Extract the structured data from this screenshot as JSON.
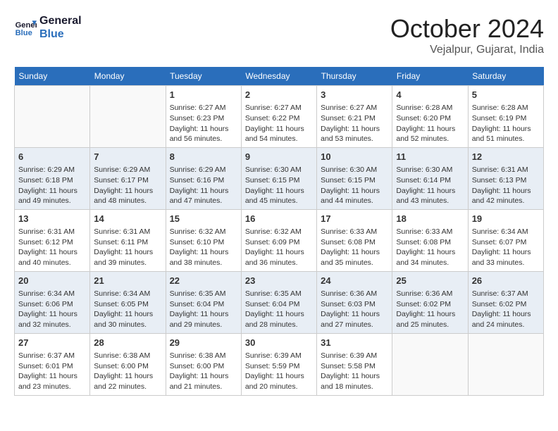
{
  "logo": {
    "line1": "General",
    "line2": "Blue"
  },
  "title": "October 2024",
  "location": "Vejalpur, Gujarat, India",
  "weekdays": [
    "Sunday",
    "Monday",
    "Tuesday",
    "Wednesday",
    "Thursday",
    "Friday",
    "Saturday"
  ],
  "weeks": [
    [
      {
        "day": null
      },
      {
        "day": null
      },
      {
        "day": "1",
        "sunrise": "6:27 AM",
        "sunset": "6:23 PM",
        "daylight": "11 hours and 56 minutes."
      },
      {
        "day": "2",
        "sunrise": "6:27 AM",
        "sunset": "6:22 PM",
        "daylight": "11 hours and 54 minutes."
      },
      {
        "day": "3",
        "sunrise": "6:27 AM",
        "sunset": "6:21 PM",
        "daylight": "11 hours and 53 minutes."
      },
      {
        "day": "4",
        "sunrise": "6:28 AM",
        "sunset": "6:20 PM",
        "daylight": "11 hours and 52 minutes."
      },
      {
        "day": "5",
        "sunrise": "6:28 AM",
        "sunset": "6:19 PM",
        "daylight": "11 hours and 51 minutes."
      }
    ],
    [
      {
        "day": "6",
        "sunrise": "6:29 AM",
        "sunset": "6:18 PM",
        "daylight": "11 hours and 49 minutes."
      },
      {
        "day": "7",
        "sunrise": "6:29 AM",
        "sunset": "6:17 PM",
        "daylight": "11 hours and 48 minutes."
      },
      {
        "day": "8",
        "sunrise": "6:29 AM",
        "sunset": "6:16 PM",
        "daylight": "11 hours and 47 minutes."
      },
      {
        "day": "9",
        "sunrise": "6:30 AM",
        "sunset": "6:15 PM",
        "daylight": "11 hours and 45 minutes."
      },
      {
        "day": "10",
        "sunrise": "6:30 AM",
        "sunset": "6:15 PM",
        "daylight": "11 hours and 44 minutes."
      },
      {
        "day": "11",
        "sunrise": "6:30 AM",
        "sunset": "6:14 PM",
        "daylight": "11 hours and 43 minutes."
      },
      {
        "day": "12",
        "sunrise": "6:31 AM",
        "sunset": "6:13 PM",
        "daylight": "11 hours and 42 minutes."
      }
    ],
    [
      {
        "day": "13",
        "sunrise": "6:31 AM",
        "sunset": "6:12 PM",
        "daylight": "11 hours and 40 minutes."
      },
      {
        "day": "14",
        "sunrise": "6:31 AM",
        "sunset": "6:11 PM",
        "daylight": "11 hours and 39 minutes."
      },
      {
        "day": "15",
        "sunrise": "6:32 AM",
        "sunset": "6:10 PM",
        "daylight": "11 hours and 38 minutes."
      },
      {
        "day": "16",
        "sunrise": "6:32 AM",
        "sunset": "6:09 PM",
        "daylight": "11 hours and 36 minutes."
      },
      {
        "day": "17",
        "sunrise": "6:33 AM",
        "sunset": "6:08 PM",
        "daylight": "11 hours and 35 minutes."
      },
      {
        "day": "18",
        "sunrise": "6:33 AM",
        "sunset": "6:08 PM",
        "daylight": "11 hours and 34 minutes."
      },
      {
        "day": "19",
        "sunrise": "6:34 AM",
        "sunset": "6:07 PM",
        "daylight": "11 hours and 33 minutes."
      }
    ],
    [
      {
        "day": "20",
        "sunrise": "6:34 AM",
        "sunset": "6:06 PM",
        "daylight": "11 hours and 32 minutes."
      },
      {
        "day": "21",
        "sunrise": "6:34 AM",
        "sunset": "6:05 PM",
        "daylight": "11 hours and 30 minutes."
      },
      {
        "day": "22",
        "sunrise": "6:35 AM",
        "sunset": "6:04 PM",
        "daylight": "11 hours and 29 minutes."
      },
      {
        "day": "23",
        "sunrise": "6:35 AM",
        "sunset": "6:04 PM",
        "daylight": "11 hours and 28 minutes."
      },
      {
        "day": "24",
        "sunrise": "6:36 AM",
        "sunset": "6:03 PM",
        "daylight": "11 hours and 27 minutes."
      },
      {
        "day": "25",
        "sunrise": "6:36 AM",
        "sunset": "6:02 PM",
        "daylight": "11 hours and 25 minutes."
      },
      {
        "day": "26",
        "sunrise": "6:37 AM",
        "sunset": "6:02 PM",
        "daylight": "11 hours and 24 minutes."
      }
    ],
    [
      {
        "day": "27",
        "sunrise": "6:37 AM",
        "sunset": "6:01 PM",
        "daylight": "11 hours and 23 minutes."
      },
      {
        "day": "28",
        "sunrise": "6:38 AM",
        "sunset": "6:00 PM",
        "daylight": "11 hours and 22 minutes."
      },
      {
        "day": "29",
        "sunrise": "6:38 AM",
        "sunset": "6:00 PM",
        "daylight": "11 hours and 21 minutes."
      },
      {
        "day": "30",
        "sunrise": "6:39 AM",
        "sunset": "5:59 PM",
        "daylight": "11 hours and 20 minutes."
      },
      {
        "day": "31",
        "sunrise": "6:39 AM",
        "sunset": "5:58 PM",
        "daylight": "11 hours and 18 minutes."
      },
      {
        "day": null
      },
      {
        "day": null
      }
    ]
  ],
  "labels": {
    "sunrise": "Sunrise:",
    "sunset": "Sunset:",
    "daylight": "Daylight:"
  }
}
